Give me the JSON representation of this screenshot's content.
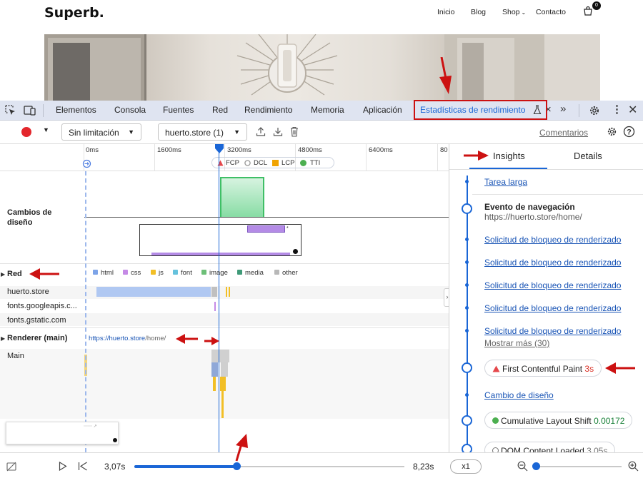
{
  "site": {
    "logo": "Superb.",
    "nav": [
      "Inicio",
      "Blog",
      "Shop",
      "Contacto"
    ],
    "cart_count": "0"
  },
  "devtools": {
    "tabs": [
      "Elementos",
      "Consola",
      "Fuentes",
      "Red",
      "Rendimiento",
      "Memoria",
      "Aplicación",
      "Estadísticas de rendimiento"
    ],
    "active_tab": "Estadísticas de rendimiento",
    "overflow_icon": "chevron-double-right"
  },
  "toolbar": {
    "throttling": "Sin limitación",
    "recording": "huerto.store (1)",
    "comments": "Comentarios"
  },
  "timeline": {
    "ticks": [
      "0ms",
      "1600ms",
      "3200ms",
      "4800ms",
      "6400ms",
      "80"
    ],
    "markers": [
      "FCP",
      "DCL",
      "LCP",
      "TTI"
    ],
    "marker_colors": {
      "FCP": "#e5474b",
      "DCL": "#9e9e9e",
      "LCP": "#f0a300",
      "TTI": "#4caf50"
    },
    "layout_shifts_label": "Cambios de diseño",
    "network_label": "Red",
    "resource_types": [
      "html",
      "css",
      "js",
      "font",
      "image",
      "media",
      "other"
    ],
    "resource_colors": {
      "html": "#7da4e8",
      "css": "#c58ae6",
      "js": "#f2bf26",
      "font": "#66c2dd",
      "image": "#6dbf78",
      "media": "#3f9a78",
      "other": "#b8b8b8"
    },
    "hosts": [
      "huerto.store",
      "fonts.googleapis.c...",
      "fonts.gstatic.com"
    ],
    "renderer_label": "Renderer (main)",
    "renderer_url_host": "https://huerto.store",
    "renderer_url_path": "/home/",
    "main_label": "Main"
  },
  "sidebar": {
    "tabs": [
      "Insights",
      "Details"
    ],
    "active_tab": "Insights",
    "long_task": "Tarea larga",
    "nav_event_title": "Evento de navegación",
    "nav_event_url": "https://huerto.store/home/",
    "render_blocking": [
      "Solicitud de bloqueo de renderizado",
      "Solicitud de bloqueo de renderizado",
      "Solicitud de bloqueo de renderizado",
      "Solicitud de bloqueo de renderizado",
      "Solicitud de bloqueo de renderizado"
    ],
    "show_more": "Mostrar más (30)",
    "fcp_label": "First Contentful Paint",
    "fcp_value": "3s",
    "layout_change": "Cambio de diseño",
    "cls_label": "Cumulative Layout Shift",
    "cls_value": "0.00172",
    "dcl_label": "DOM Content Loaded",
    "dcl_value": "3,05s"
  },
  "playback": {
    "current_time": "3,07s",
    "end_time": "8,23s",
    "position": 0.38,
    "speed": "x1"
  },
  "colors": {
    "accent": "#1a66d6",
    "annotation_red": "#cc1111",
    "record": "#e3262c"
  }
}
